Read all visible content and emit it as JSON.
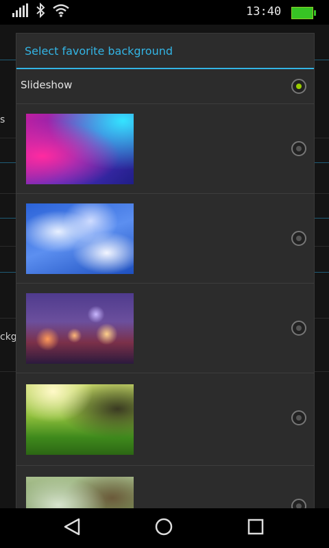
{
  "status": {
    "time": "13:40"
  },
  "dialog": {
    "title": "Select favorite background",
    "items": [
      {
        "label": "Slideshow",
        "selected": true
      },
      {
        "label": "",
        "selected": false,
        "thumbnail": "pink-blue-blur"
      },
      {
        "label": "",
        "selected": false,
        "thumbnail": "blue-white-clouds-blur"
      },
      {
        "label": "",
        "selected": false,
        "thumbnail": "city-bokeh-night"
      },
      {
        "label": "",
        "selected": false,
        "thumbnail": "green-grass-sunlight"
      },
      {
        "label": "",
        "selected": false,
        "thumbnail": "tree-blur"
      }
    ]
  },
  "underlay_fragments": {
    "frag1": "s",
    "frag2": "ckgr"
  },
  "icons": {
    "signal": "signal-icon",
    "bluetooth": "bluetooth-icon",
    "wifi": "wifi-icon",
    "battery": "battery-icon",
    "back": "back-icon",
    "home": "home-icon",
    "recents": "recents-icon"
  },
  "colors": {
    "accent": "#33b5e5",
    "radio_selected": "#99cc00",
    "battery": "#37c424"
  }
}
